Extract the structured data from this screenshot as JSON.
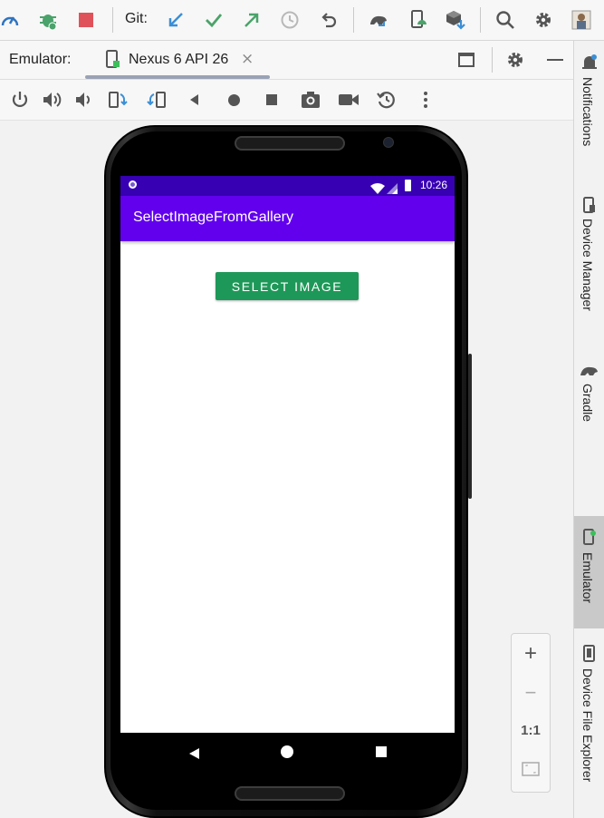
{
  "toolbar": {
    "git_label": "Git:",
    "icons": [
      "profiler-icon",
      "debug-icon",
      "stop-icon",
      "git-update-icon",
      "git-commit-icon",
      "git-push-icon",
      "history-icon",
      "rollback-icon",
      "gradle-sync-icon",
      "device-manager-icon",
      "sdk-manager-icon",
      "search-icon",
      "settings-icon",
      "project-structure-icon"
    ]
  },
  "emulator_header": {
    "label": "Emulator:",
    "device_tab": "Nexus 6 API 26",
    "close": "×"
  },
  "emulator_controls": [
    "power-icon",
    "volume-up-icon",
    "volume-down-icon",
    "rotate-left-icon",
    "rotate-right-icon",
    "back-icon",
    "home-icon",
    "overview-icon",
    "screenshot-icon",
    "screen-record-icon",
    "snapshot-icon",
    "more-icon"
  ],
  "device": {
    "status_time": "10:26",
    "app_title": "SelectImageFromGallery",
    "button_label": "SELECT IMAGE"
  },
  "side_panel": {
    "items": [
      "Notifications",
      "Device Manager",
      "Gradle",
      "Emulator",
      "Device File Explorer"
    ],
    "active": "Emulator"
  },
  "zoom": {
    "zoom_in": "+",
    "zoom_out": "−",
    "actual_size": "1:1"
  },
  "colors": {
    "status_bar": "#3700b3",
    "app_bar": "#6200ee",
    "button": "#1e9858"
  }
}
